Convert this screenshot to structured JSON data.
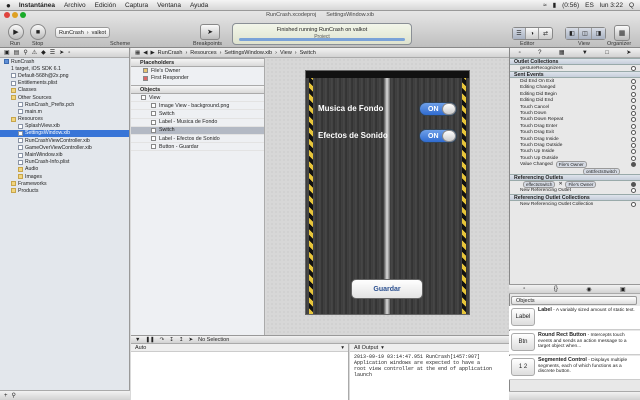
{
  "menubar": {
    "apple": "",
    "items": [
      "Instantánea",
      "Archivo",
      "Edición",
      "Captura",
      "Ventana",
      "Ayuda"
    ],
    "status": {
      "battery": "(0:56)",
      "flag": "ES",
      "time": "lun 3:22",
      "search": "Q"
    }
  },
  "window": {
    "tabs": [
      "RunCrash.xcodeproj",
      "SettingsWindow.xib"
    ]
  },
  "toolbar": {
    "run_label": "Run",
    "stop_label": "Stop",
    "scheme_label": "Scheme",
    "breakpoints_label": "Breakpoints",
    "scheme_target": "RunCrash",
    "scheme_device": "valkot",
    "status_text": "Finished running RunCrash on valkot",
    "project_badge": "Project",
    "editor_label": "Editor",
    "view_label": "View",
    "organizer_label": "Organizer"
  },
  "navigator": {
    "items": [
      {
        "label": "RunCrash",
        "indent": 0,
        "kind": "proj",
        "selected": false
      },
      {
        "label": "1 target, iOS SDK 6.1",
        "indent": 1,
        "kind": "none",
        "selected": false
      },
      {
        "label": "Default-568h@2x.png",
        "indent": 1,
        "kind": "file",
        "selected": false
      },
      {
        "label": "Entitlements.plist",
        "indent": 1,
        "kind": "file",
        "selected": false
      },
      {
        "label": "Classes",
        "indent": 1,
        "kind": "folder",
        "selected": false
      },
      {
        "label": "Other Sources",
        "indent": 1,
        "kind": "folder",
        "selected": false
      },
      {
        "label": "RunCrash_Prefix.pch",
        "indent": 2,
        "kind": "file",
        "selected": false
      },
      {
        "label": "main.m",
        "indent": 2,
        "kind": "file",
        "selected": false
      },
      {
        "label": "Resources",
        "indent": 1,
        "kind": "folder",
        "selected": false
      },
      {
        "label": "SplashView.xib",
        "indent": 2,
        "kind": "file",
        "selected": false
      },
      {
        "label": "SettingsWindow.xib",
        "indent": 2,
        "kind": "file",
        "selected": true
      },
      {
        "label": "RunCrashViewController.xib",
        "indent": 2,
        "kind": "file",
        "selected": false
      },
      {
        "label": "GameOverViewController.xib",
        "indent": 2,
        "kind": "file",
        "selected": false
      },
      {
        "label": "MainWindow.xib",
        "indent": 2,
        "kind": "file",
        "selected": false
      },
      {
        "label": "RunCrash-Info.plist",
        "indent": 2,
        "kind": "file",
        "selected": false
      },
      {
        "label": "Audio",
        "indent": 2,
        "kind": "folder",
        "selected": false
      },
      {
        "label": "Images",
        "indent": 2,
        "kind": "folder",
        "selected": false
      },
      {
        "label": "Frameworks",
        "indent": 1,
        "kind": "folder",
        "selected": false
      },
      {
        "label": "Products",
        "indent": 1,
        "kind": "folder",
        "selected": false
      }
    ]
  },
  "jumpbar": {
    "crumbs": [
      "RunCrash",
      "Resources",
      "SettingsWindow.xib",
      "View",
      "Switch"
    ]
  },
  "dock": {
    "placeholders_title": "Placeholders",
    "placeholders": [
      "File's Owner",
      "First Responder"
    ],
    "objects_title": "Objects",
    "objects": [
      {
        "label": "View",
        "indent": 0,
        "selected": false
      },
      {
        "label": "Image View - background.png",
        "indent": 1,
        "selected": false
      },
      {
        "label": "Switch",
        "indent": 1,
        "selected": false
      },
      {
        "label": "Label - Musica de Fondo",
        "indent": 1,
        "selected": false
      },
      {
        "label": "Switch",
        "indent": 1,
        "selected": true
      },
      {
        "label": "Label - Efectos de Sonido",
        "indent": 1,
        "selected": false
      },
      {
        "label": "Button - Guardar",
        "indent": 1,
        "selected": false
      }
    ]
  },
  "canvas": {
    "label_music": "Musica de Fondo",
    "label_effects": "Efectos de Sonido",
    "switch_on": "ON",
    "switch_on_2": "ON",
    "button_save": "Guardar"
  },
  "debugbar": {
    "selection": "No Selection"
  },
  "variables": {
    "scope": "Auto",
    "clear": "Clear"
  },
  "console": {
    "filter": "All Output",
    "log": "2013-09-19 03:14:47.951 RunCrash[1457:907]\nApplication windows are expected to have a\nroot view controller at the end of application\nlaunch"
  },
  "inspector": {
    "outlet_collections_title": "Outlet Collections",
    "outlet_collections": [
      "gestureRecognizers"
    ],
    "sent_events_title": "Sent Events",
    "sent_events": [
      "Did End On Exit",
      "Editing Changed",
      "Editing Did Begin",
      "Editing Did End",
      "Touch Cancel",
      "Touch Down",
      "Touch Down Repeat",
      "Touch Drag Enter",
      "Touch Drag Exit",
      "Touch Drag Inside",
      "Touch Drag Outside",
      "Touch Up Inside",
      "Touch Up Outside"
    ],
    "value_changed": "Value Changed",
    "value_changed_target": "File's Owner",
    "value_changed_action": "onEfectsSwitch",
    "referencing_outlets_title": "Referencing Outlets",
    "referencing_outlet_name": "effectsSwitch",
    "referencing_outlet_target": "File's Owner",
    "new_referencing_outlet": "New Referencing Outlet",
    "referencing_collections_title": "Referencing Outlet Collections",
    "new_referencing_collection": "New Referencing Outlet Collection"
  },
  "library": {
    "category": "Objects",
    "items": [
      {
        "icon": "Label",
        "title": "Label",
        "desc": " - A variably sized amount of static text."
      },
      {
        "icon": "Btn",
        "title": "Round Rect Button",
        "desc": " - Intercepts touch events and sends an action message to a target object when..."
      },
      {
        "icon": "1 2",
        "title": "Segmented Control",
        "desc": " - Displays multiple segments, each of which functions as a discrete button."
      }
    ]
  }
}
